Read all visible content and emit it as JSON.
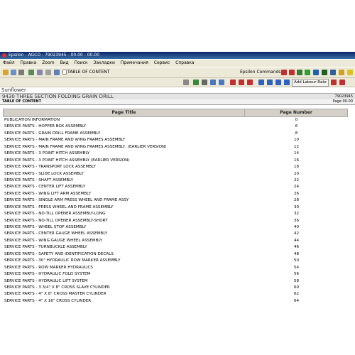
{
  "window": {
    "title": "Epsilon - AGCO - 79023945 - 00.00 - 00.00"
  },
  "menu": [
    "Файл",
    "Правка",
    "Zoom",
    "Вид",
    "Поиск",
    "Закладки",
    "Примечания",
    "Сервис",
    "Справка"
  ],
  "toolbar": {
    "toc_label": "TABLE OF CONTENT",
    "epsilon_commands": "Epsilon Commands ->",
    "add_labour_rate": "Add Labour Rate"
  },
  "doc": {
    "manufacturer": "Sunflower",
    "model": "9430 THREE SECTION FOLDING GRAIN DRILL",
    "code": "79023945",
    "section": "TABLE OF CONTENT",
    "page": "Page 00-00"
  },
  "table": {
    "headers": [
      "Page Title",
      "Page Number"
    ],
    "rows": [
      [
        "PUBLICATION INFORMATION",
        "0"
      ],
      [
        "SERVICE PARTS - HOPPER BOX ASSEMBLY",
        "6"
      ],
      [
        "SERVICE PARTS - GRAIN DRILL FRAME ASSEMBLY",
        "8"
      ],
      [
        "SERVICE PARTS - MAIN FRAME AND WING FRAMES ASSEMBLY",
        "10"
      ],
      [
        "SERVICE PARTS - MAIN FRAME AND WING FRAMES ASSEMBLY, (EARLIER VERSION)",
        "12"
      ],
      [
        "SERVICE PARTS - 3 POINT HITCH ASSEMBLY",
        "14"
      ],
      [
        "SERVICE PARTS - 3 POINT HITCH ASSEMBLY (EARLIER VERSION)",
        "16"
      ],
      [
        "SERVICE PARTS - TRANSPORT LOCK ASSEMBLY",
        "18"
      ],
      [
        "SERVICE PARTS - SLIDE LOCK ASSEMBLY",
        "20"
      ],
      [
        "SERVICE PARTS - SHAFT ASSEMBLY",
        "22"
      ],
      [
        "SERVICE PARTS - CENTER LIFT ASSEMBLY",
        "24"
      ],
      [
        "SERVICE PARTS - WING LIFT ARM ASSEMBLY",
        "26"
      ],
      [
        "SERVICE PARTS - SINGLE ARM PRESS WHEEL AND FRAME ASSY",
        "28"
      ],
      [
        "SERVICE PARTS - PRESS WHEEL AND FRAME ASSEMBLY",
        "30"
      ],
      [
        "SERVICE PARTS - NO-TILL OPENER ASSEMBLY-LONG",
        "32"
      ],
      [
        "SERVICE PARTS - NO-TILL OPENER ASSEMBLY-SHORT",
        "36"
      ],
      [
        "SERVICE PARTS - WHEEL STOP ASSEMBLY",
        "40"
      ],
      [
        "SERVICE PARTS - CENTER GAUGE WHEEL ASSEMBLY",
        "42"
      ],
      [
        "SERVICE PARTS - WING GAUGE WHEEL ASSEMBLY",
        "44"
      ],
      [
        "SERVICE PARTS - TURNBUCKLE ASSEMBLY",
        "46"
      ],
      [
        "SERVICE PARTS - SAFETY AND IDENTIFICATION DECALS",
        "48"
      ],
      [
        "SERVICE PARTS - 30\" HYDRAULIC ROW MARKER ASSEMBLY",
        "50"
      ],
      [
        "SERVICE PARTS - ROW MARKER HYDRAULICS",
        "54"
      ],
      [
        "SERVICE PARTS - HYDRAULIC FOLD SYSTEM",
        "56"
      ],
      [
        "SERVICE PARTS - HYDRAULIC LIFT SYSTEM",
        "58"
      ],
      [
        "SERVICE PARTS - 3 3/4\" X 8\" CROSS SLAVE CYLINDER",
        "60"
      ],
      [
        "SERVICE PARTS - 4\" X 8\" CROSS MASTER CYLINDER",
        "62"
      ],
      [
        "SERVICE PARTS - 4\" X 16\" CROSS CYLINDER",
        "64"
      ]
    ]
  }
}
